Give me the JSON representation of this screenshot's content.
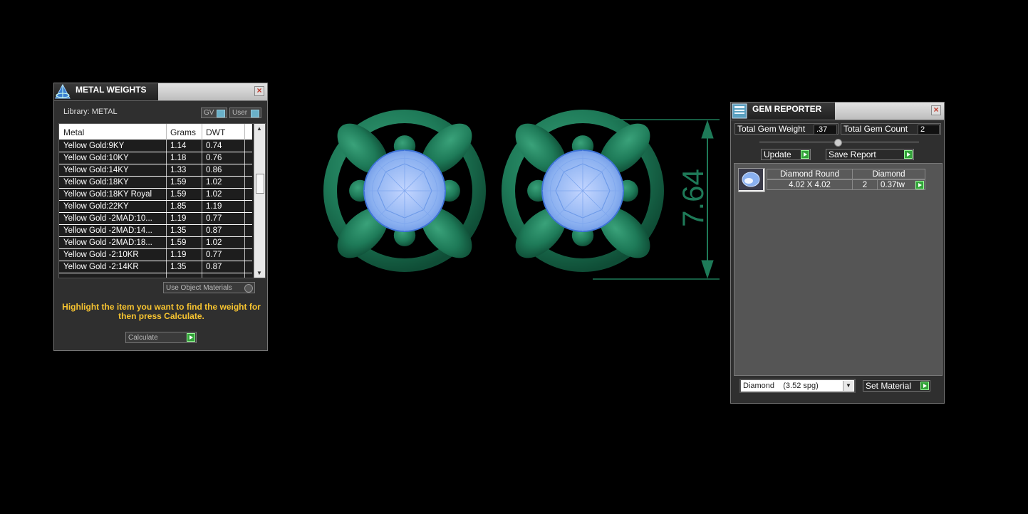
{
  "metal_weights": {
    "title": "METAL WEIGHTS",
    "library_label": "Library: METAL",
    "toggle_gv": "GV",
    "toggle_user": "User",
    "columns": [
      "Metal",
      "Grams",
      "DWT"
    ],
    "rows": [
      {
        "metal": "Yellow Gold:9KY",
        "grams": "1.14",
        "dwt": "0.74"
      },
      {
        "metal": "Yellow Gold:10KY",
        "grams": "1.18",
        "dwt": "0.76"
      },
      {
        "metal": "Yellow Gold:14KY",
        "grams": "1.33",
        "dwt": "0.86"
      },
      {
        "metal": "Yellow Gold:18KY",
        "grams": "1.59",
        "dwt": "1.02"
      },
      {
        "metal": "Yellow Gold:18KY Royal",
        "grams": "1.59",
        "dwt": "1.02"
      },
      {
        "metal": "Yellow Gold:22KY",
        "grams": "1.85",
        "dwt": "1.19"
      },
      {
        "metal": "Yellow Gold -2MAD:10...",
        "grams": "1.19",
        "dwt": "0.77"
      },
      {
        "metal": "Yellow Gold -2MAD:14...",
        "grams": "1.35",
        "dwt": "0.87"
      },
      {
        "metal": "Yellow Gold -2MAD:18...",
        "grams": "1.59",
        "dwt": "1.02"
      },
      {
        "metal": "Yellow Gold -2:10KR",
        "grams": "1.19",
        "dwt": "0.77"
      },
      {
        "metal": "Yellow Gold -2:14KR",
        "grams": "1.35",
        "dwt": "0.87"
      }
    ],
    "use_object_materials": "Use Object Materials",
    "hint": "Highlight the item you want to find the weight for then press Calculate.",
    "calculate_label": "Calculate"
  },
  "gem_reporter": {
    "title": "GEM REPORTER",
    "total_weight_label": "Total Gem Weight",
    "total_weight_value": ".37",
    "total_count_label": "Total Gem Count",
    "total_count_value": "2",
    "update_label": "Update",
    "save_report_label": "Save Report",
    "gem": {
      "shape": "Diamond Round",
      "size": "4.02 X 4.02",
      "material": "Diamond",
      "count": "2",
      "weight": "0.37tw"
    },
    "material_select": "Diamond    (3.52 spg)",
    "set_material_label": "Set Material"
  },
  "viewport": {
    "dimension_label": "7.64"
  },
  "colors": {
    "metal": "#1e7a58",
    "gem": "#8ab0f0",
    "hint": "#f6c330",
    "go_button": "#33a33a"
  }
}
